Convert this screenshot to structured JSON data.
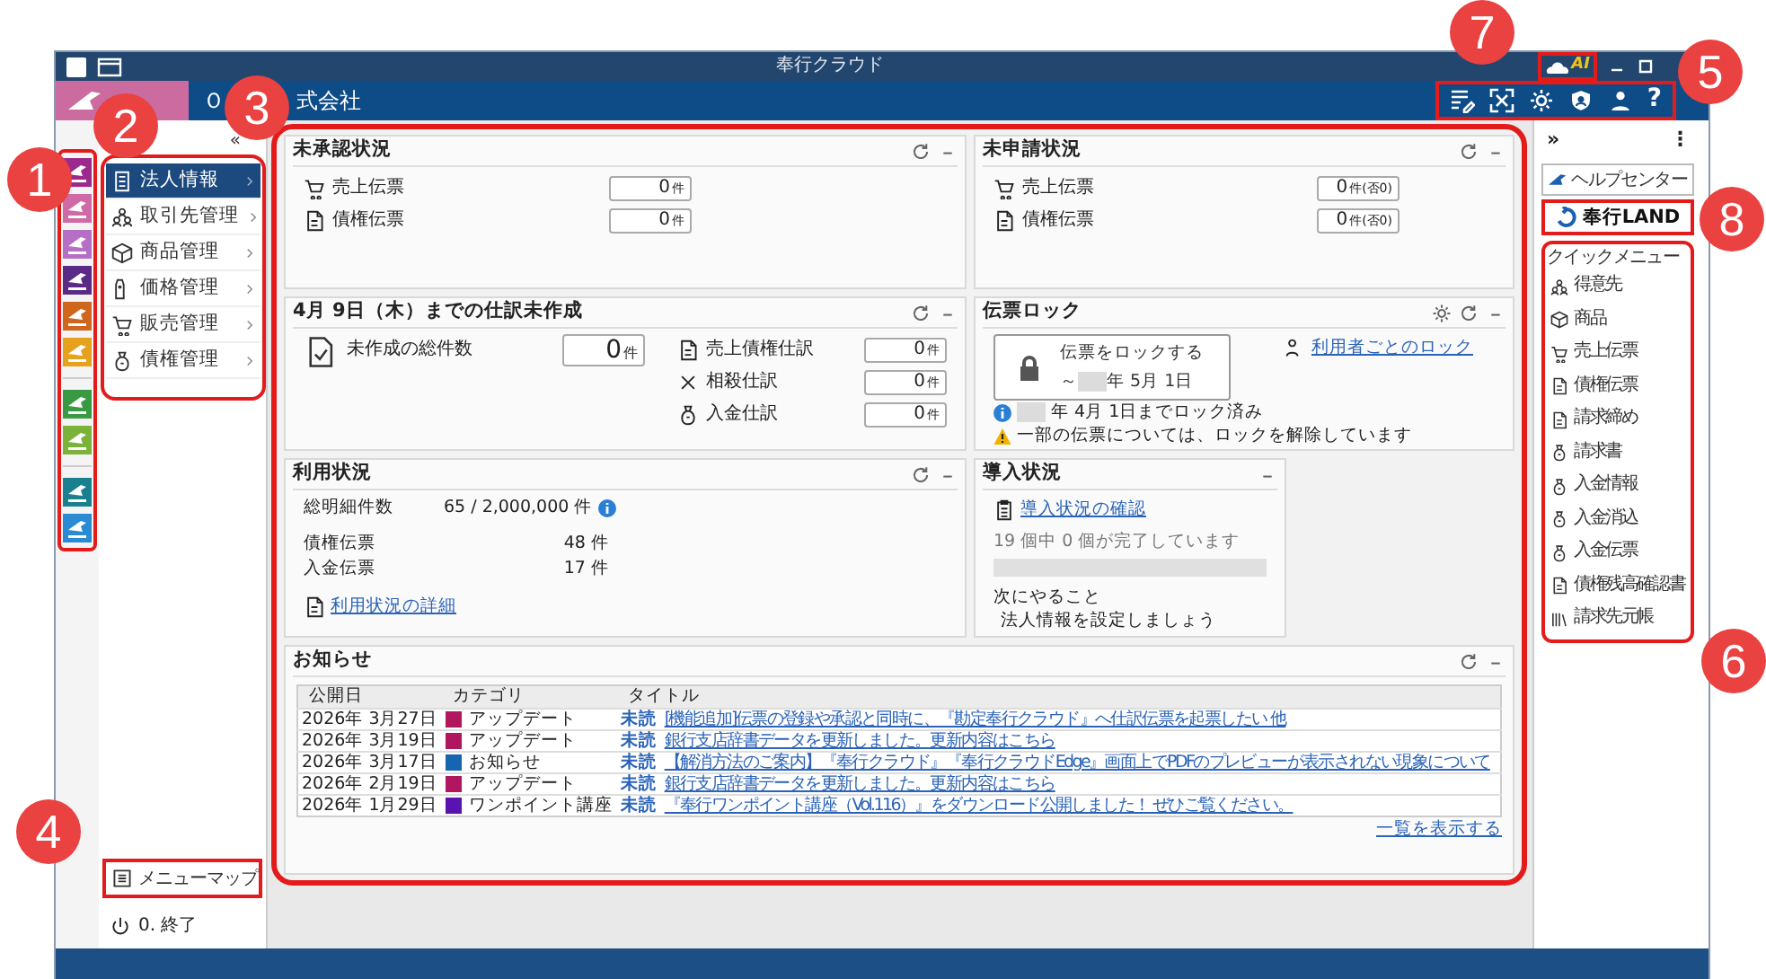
{
  "title_bar": {
    "title": "奉行クラウド",
    "ai_label": "AI"
  },
  "header": {
    "company_parts": [
      "Ｏ",
      "式会社"
    ],
    "help_glyph": "?"
  },
  "rail": {
    "items": [
      {
        "color": "#9c2a8c"
      },
      {
        "color": "#cf6aa6"
      },
      {
        "color": "#b56fc4"
      },
      {
        "color": "#5a2a86"
      },
      {
        "color": "#d0661e"
      },
      {
        "color": "#e6a21c"
      },
      {
        "color": "#3a9a44"
      },
      {
        "color": "#7bb33a"
      },
      {
        "color": "#1a7f8e"
      },
      {
        "color": "#2a8ad4"
      }
    ]
  },
  "nav": {
    "collapse": "«",
    "items": [
      {
        "label": "法人情報",
        "selected": true
      },
      {
        "label": "取引先管理",
        "selected": false
      },
      {
        "label": "商品管理",
        "selected": false
      },
      {
        "label": "価格管理",
        "selected": false
      },
      {
        "label": "販売管理",
        "selected": false
      },
      {
        "label": "債権管理",
        "selected": false
      }
    ],
    "menu_map": "メニューマップ",
    "exit": "0. 終了"
  },
  "unapproved": {
    "title": "未承認状況",
    "rows": [
      {
        "label": "売上伝票",
        "value": "0",
        "unit": "件"
      },
      {
        "label": "債権伝票",
        "value": "0",
        "unit": "件"
      }
    ]
  },
  "unsubmitted": {
    "title": "未申請状況",
    "rows": [
      {
        "label": "売上伝票",
        "value": "0",
        "unit": "件(否0)"
      },
      {
        "label": "債権伝票",
        "value": "0",
        "unit": "件(否0)"
      }
    ]
  },
  "journal": {
    "title": "4月 9日（木）までの仕訳未作成",
    "total": {
      "label": "未作成の総件数",
      "value": "0",
      "unit": "件"
    },
    "rows": [
      {
        "label": "売上債権仕訳",
        "value": "0",
        "unit": "件"
      },
      {
        "label": "相殺仕訳",
        "value": "0",
        "unit": "件"
      },
      {
        "label": "入金仕訳",
        "value": "0",
        "unit": "件"
      }
    ]
  },
  "lock": {
    "title": "伝票ロック",
    "button_line1": "伝票をロックする",
    "button_prefix": "～",
    "button_date": "年 5月 1日",
    "user_link": "利用者ごとのロック",
    "locked_until": "年 4月 1日までロック済み",
    "warning": "一部の伝票については、ロックを解除しています"
  },
  "usage": {
    "title": "利用状況",
    "total_label": "総明細件数",
    "total_value": "65 / 2,000,000 件",
    "rows": [
      {
        "label": "債権伝票",
        "value": "48 件"
      },
      {
        "label": "入金伝票",
        "value": "17 件"
      }
    ],
    "detail_link": "利用状況の詳細"
  },
  "intro": {
    "title": "導入状況",
    "link": "導入状況の確認",
    "progress_text": "19 個中 0 個が完了しています",
    "level": 0,
    "next_label": "次にやること",
    "next_text": "法人情報を設定しましょう"
  },
  "news": {
    "title": "お知らせ",
    "columns": [
      "公開日",
      "カテゴリ",
      "タイトル"
    ],
    "rows": [
      {
        "date": "2026年 3月27日",
        "category": "アップデート",
        "color": "#b0175e",
        "status": "未読",
        "title": "[機能追加]伝票の登録や承認と同時に、『勘定奉行クラウド』へ仕訳伝票を起票したい 他"
      },
      {
        "date": "2026年 3月19日",
        "category": "アップデート",
        "color": "#b0175e",
        "status": "未読",
        "title": "銀行支店辞書データを更新しました。更新内容はこちら"
      },
      {
        "date": "2026年 3月17日",
        "category": "お知らせ",
        "color": "#1565b0",
        "status": "未読",
        "title": "【解消方法のご案内】『奉行クラウド』『奉行クラウドEdge』画面上でPDFのプレビューが表示されない現象について"
      },
      {
        "date": "2026年 2月19日",
        "category": "アップデート",
        "color": "#b0175e",
        "status": "未読",
        "title": "銀行支店辞書データを更新しました。更新内容はこちら"
      },
      {
        "date": "2026年 1月29日",
        "category": "ワンポイント講座",
        "color": "#5a12b0",
        "status": "未読",
        "title": "『奉行ワンポイント講座（Vol.116）』をダウンロード公開しました！ ぜひご覧ください。"
      }
    ],
    "more_link": "一覧を表示する"
  },
  "right_panel": {
    "expand": "»",
    "more": "⋮",
    "help": "ヘルプセンター",
    "land": "奉行LAND",
    "quick_menu": {
      "title": "クイックメニュー",
      "items": [
        "得意先",
        "商品",
        "売上伝票",
        "債権伝票",
        "請求締め",
        "請求書",
        "入金情報",
        "入金消込",
        "入金伝票",
        "債権残高確認書",
        "請求先元帳"
      ]
    }
  },
  "callouts": [
    "1",
    "2",
    "3",
    "4",
    "5",
    "6",
    "7",
    "8"
  ]
}
